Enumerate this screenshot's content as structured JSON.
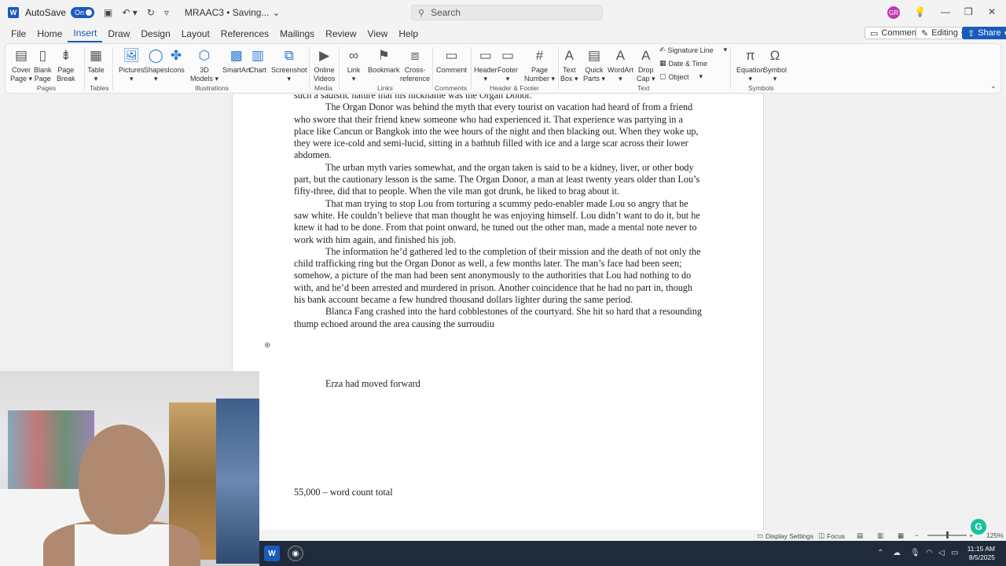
{
  "titlebar": {
    "autosave_label": "AutoSave",
    "autosave_state": "On",
    "doc_title": "MRAAC3 • Saving...",
    "search_placeholder": "Search",
    "avatar_initials": "GR"
  },
  "menu": {
    "tabs": [
      "File",
      "Home",
      "Insert",
      "Draw",
      "Design",
      "Layout",
      "References",
      "Mailings",
      "Review",
      "View",
      "Help"
    ],
    "active": "Insert",
    "comments_label": "Comments",
    "editing_label": "Editing",
    "share_label": "Share"
  },
  "ribbon": {
    "items": [
      {
        "label1": "Cover",
        "label2": "Page ▾",
        "icon": "cover-page-icon"
      },
      {
        "label1": "Blank",
        "label2": "Page",
        "icon": "blank-page-icon"
      },
      {
        "label1": "Page",
        "label2": "Break",
        "icon": "page-break-icon"
      },
      {
        "label1": "Table",
        "label2": "▾",
        "icon": "table-icon"
      },
      {
        "label1": "Pictures",
        "label2": "▾",
        "icon": "pictures-icon"
      },
      {
        "label1": "Shapes",
        "label2": "▾",
        "icon": "shapes-icon"
      },
      {
        "label1": "Icons",
        "label2": "",
        "icon": "icons-icon"
      },
      {
        "label1": "3D",
        "label2": "Models ▾",
        "icon": "3d-models-icon"
      },
      {
        "label1": "SmartArt",
        "label2": "",
        "icon": "smartart-icon"
      },
      {
        "label1": "Chart",
        "label2": "",
        "icon": "chart-icon"
      },
      {
        "label1": "Screenshot",
        "label2": "▾",
        "icon": "screenshot-icon"
      },
      {
        "label1": "Online",
        "label2": "Videos",
        "icon": "online-videos-icon"
      },
      {
        "label1": "Link",
        "label2": "▾",
        "icon": "link-icon"
      },
      {
        "label1": "Bookmark",
        "label2": "",
        "icon": "bookmark-icon"
      },
      {
        "label1": "Cross-",
        "label2": "reference",
        "icon": "cross-reference-icon"
      },
      {
        "label1": "Comment",
        "label2": "",
        "icon": "comment-icon"
      },
      {
        "label1": "Header",
        "label2": "▾",
        "icon": "header-icon"
      },
      {
        "label1": "Footer",
        "label2": "▾",
        "icon": "footer-icon"
      },
      {
        "label1": "Page",
        "label2": "Number ▾",
        "icon": "page-number-icon"
      },
      {
        "label1": "Text",
        "label2": "Box ▾",
        "icon": "text-box-icon"
      },
      {
        "label1": "Quick",
        "label2": "Parts ▾",
        "icon": "quick-parts-icon"
      },
      {
        "label1": "WordArt",
        "label2": "▾",
        "icon": "wordart-icon"
      },
      {
        "label1": "Drop",
        "label2": "Cap ▾",
        "icon": "drop-cap-icon"
      },
      {
        "label1": "Equation",
        "label2": "▾",
        "icon": "equation-icon"
      },
      {
        "label1": "Symbol",
        "label2": "▾",
        "icon": "symbol-icon"
      }
    ],
    "small": [
      "Signature Line",
      "Date & Time",
      "Object"
    ],
    "groups": [
      "Pages",
      "Tables",
      "Illustrations",
      "Media",
      "Links",
      "Comments",
      "Header & Footer",
      "Text",
      "Symbols"
    ]
  },
  "document": {
    "line0": "such a sadistic nature that his nickname was the Organ Donor.",
    "paragraphs": [
      "The Organ Donor was behind the myth that every tourist on vacation had heard of from a friend who swore that their friend knew someone who had experienced it.  That experience was partying in a place like Cancun or Bangkok into the wee hours of the night and then blacking out. When they woke up, they were ice-cold and semi-lucid, sitting in a bathtub filled with ice and a large scar across their lower abdomen.",
      "The urban myth varies somewhat, and the organ taken is said to be a kidney, liver, or other body part, but the cautionary lesson is the same. The Organ Donor, a man at least twenty years older than Lou’s fifty-three, did that to people. When the vile man got drunk, he liked to brag about it.",
      "That man trying to stop Lou from torturing a scummy pedo-enabler made Lou so angry that he saw white. He couldn’t believe that man thought he was enjoying himself. Lou didn’t want to do it, but he knew it had to be done. From that point onward, he tuned out the other man, made a mental note never to work with him again, and finished his job.",
      "The information he’d gathered led to the completion of their mission and the death of not only the child trafficking ring but the Organ Donor as well, a few months later. The man’s face had been seen; somehow, a picture of the man had been sent anonymously to the authorities that Lou had nothing to do with, and he’d been arrested and murdered in prison. Another coincidence that he had no part in, though his bank account became a few hundred thousand dollars lighter during the same period.",
      "Blanca Fang crashed into the hard cobblestones of the courtyard. She hit so hard that a resounding thump echoed around the area causing the surroudiu"
    ],
    "erza_line": "Erza had moved forward",
    "word_count_line": "55,000 – word count total"
  },
  "statusbar": {
    "display_settings": "Display Settings",
    "focus": "Focus",
    "zoom": "125%"
  },
  "taskbar": {
    "time": "11:15 AM",
    "date": "8/5/2025"
  },
  "colors": {
    "accent": "#185abd",
    "grammarly": "#15c39a"
  }
}
